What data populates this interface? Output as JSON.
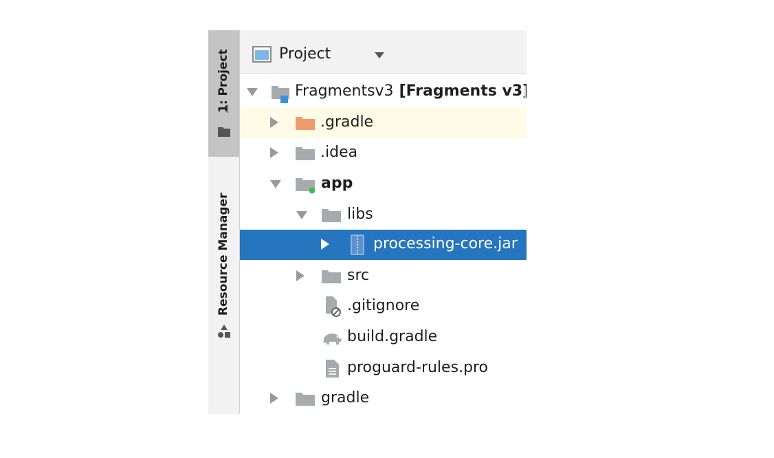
{
  "toolstrip": {
    "project_tab": {
      "number": "1",
      "rest": ": Project",
      "icon": "folder-icon"
    },
    "resource_tab": {
      "label": "Resource Manager",
      "icon": "resource-manager-icon"
    }
  },
  "header": {
    "title": "Project",
    "icon": "project-window-icon",
    "dropdown_icon": "chevron-down-icon"
  },
  "tree": {
    "root": {
      "name": "Fragmentsv3",
      "module": "[Fragments v3]",
      "expanded": true
    },
    "items": [
      {
        "label": ".gradle",
        "type": "folder",
        "expanded": false,
        "color": "#f09b6b"
      },
      {
        "label": ".idea",
        "type": "folder",
        "expanded": false
      },
      {
        "label": "app",
        "type": "module-folder",
        "expanded": true
      },
      {
        "label": "libs",
        "type": "folder",
        "expanded": true
      },
      {
        "label": "processing-core.jar",
        "type": "jar",
        "expanded": false,
        "selected": true
      },
      {
        "label": "src",
        "type": "folder",
        "expanded": false
      },
      {
        "label": ".gitignore",
        "type": "ignore-file"
      },
      {
        "label": "build.gradle",
        "type": "gradle-file"
      },
      {
        "label": "proguard-rules.pro",
        "type": "text-file"
      },
      {
        "label": "gradle",
        "type": "folder",
        "expanded": false
      }
    ]
  },
  "colors": {
    "selection": "#2675bf",
    "highlight": "#fefce6",
    "folder": "#a7abaf",
    "gradle_folder": "#f09b6b",
    "module_dot": "#3bbf4a",
    "module_badge": "#3a93d8"
  }
}
